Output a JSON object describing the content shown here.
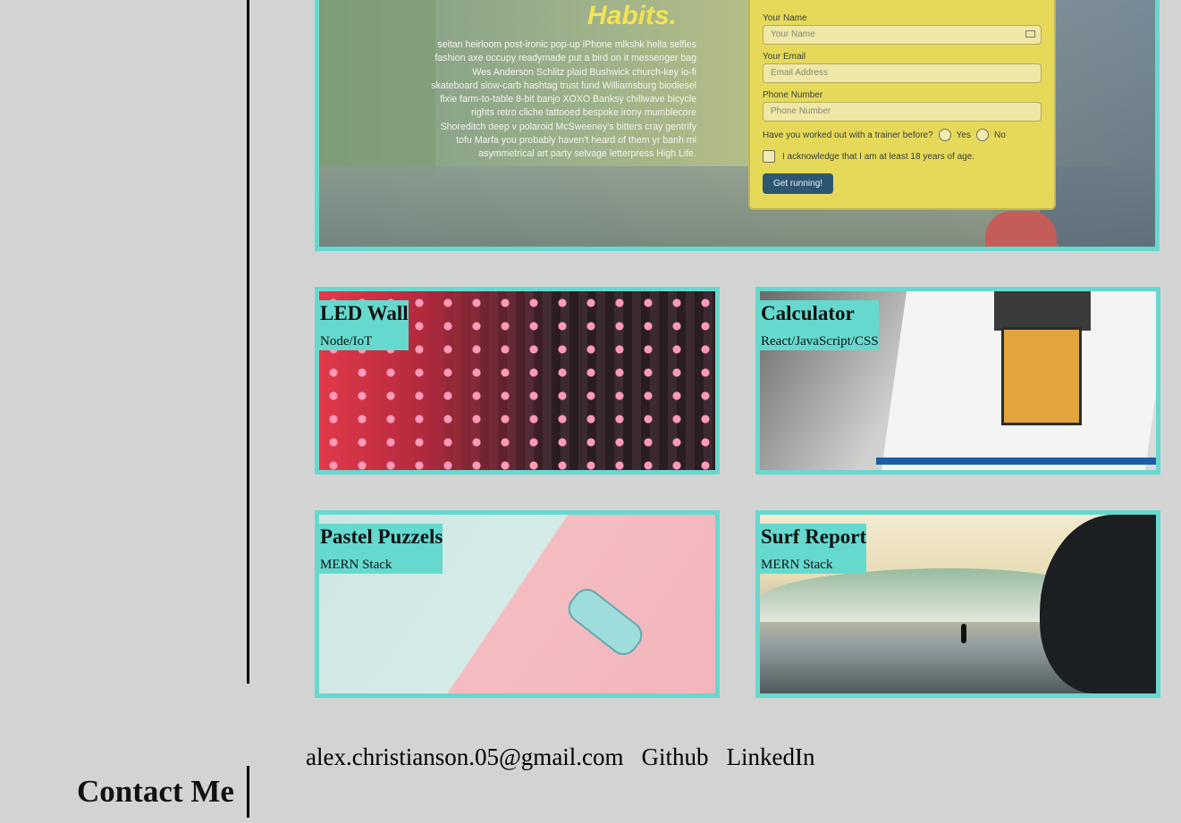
{
  "featured": {
    "heading": "Habits.",
    "description": "seitan heirloom post-ironic pop-up iPhone mlkshk hella selfies fashion axe occupy readymade put a bird on it messenger bag Wes Anderson Schlitz plaid Bushwick church-key lo-fi skateboard slow-carb hashtag trust fund Williamsburg biodiesel fixie farm-to-table 8-bit banjo XOXO Banksy chillwave bicycle rights retro cliche tattooed bespoke irony mumblecore Shoreditch deep v polaroid McSweeney's bitters cray gentrify tofu Marfa you probably haven't heard of them yr banh mi asymmetrical art party selvage letterpress High Life.",
    "form": {
      "name_label": "Your Name",
      "name_placeholder": "Your Name",
      "email_label": "Your Email",
      "email_placeholder": "Email Address",
      "phone_label": "Phone Number",
      "phone_placeholder": "Phone Number",
      "trainer_question": "Have you worked out with a trainer before?",
      "yes_label": "Yes",
      "no_label": "No",
      "acknowledge": "I acknowledge that I am at least 18 years of age.",
      "submit": "Get running!"
    }
  },
  "projects": [
    {
      "title": "LED Wall",
      "tech": "Node/IoT"
    },
    {
      "title": "Calculator",
      "tech": "React/JavaScript/CSS"
    },
    {
      "title": "Pastel Puzzels",
      "tech": "MERN Stack"
    },
    {
      "title": "Surf Report",
      "tech": "MERN Stack"
    }
  ],
  "contact": {
    "title": "Contact Me",
    "email": "alex.christianson.05@gmail.com",
    "github": "Github",
    "linkedin": "LinkedIn"
  },
  "colors": {
    "accent": "#66d9cf",
    "background": "#d3d3d3"
  }
}
